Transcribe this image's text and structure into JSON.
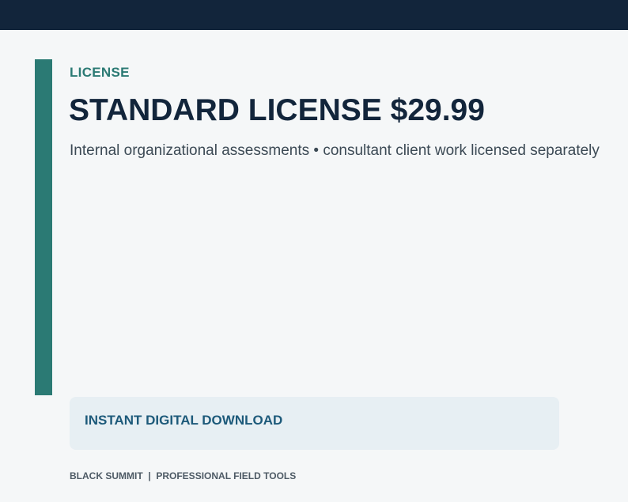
{
  "colors": {
    "header": "#12253b",
    "accent": "#2b7a74",
    "title": "#12253b",
    "download_text": "#1d5a7a",
    "download_bg": "#e7eff3",
    "background": "#f5f7f8"
  },
  "license": {
    "eyebrow": "LICENSE",
    "title": "STANDARD LICENSE $29.99",
    "subtitle": "Internal organizational assessments • consultant client work licensed separately"
  },
  "download": {
    "label": "INSTANT DIGITAL DOWNLOAD"
  },
  "footer": {
    "text": "BLACK SUMMIT  |  PROFESSIONAL FIELD TOOLS"
  }
}
